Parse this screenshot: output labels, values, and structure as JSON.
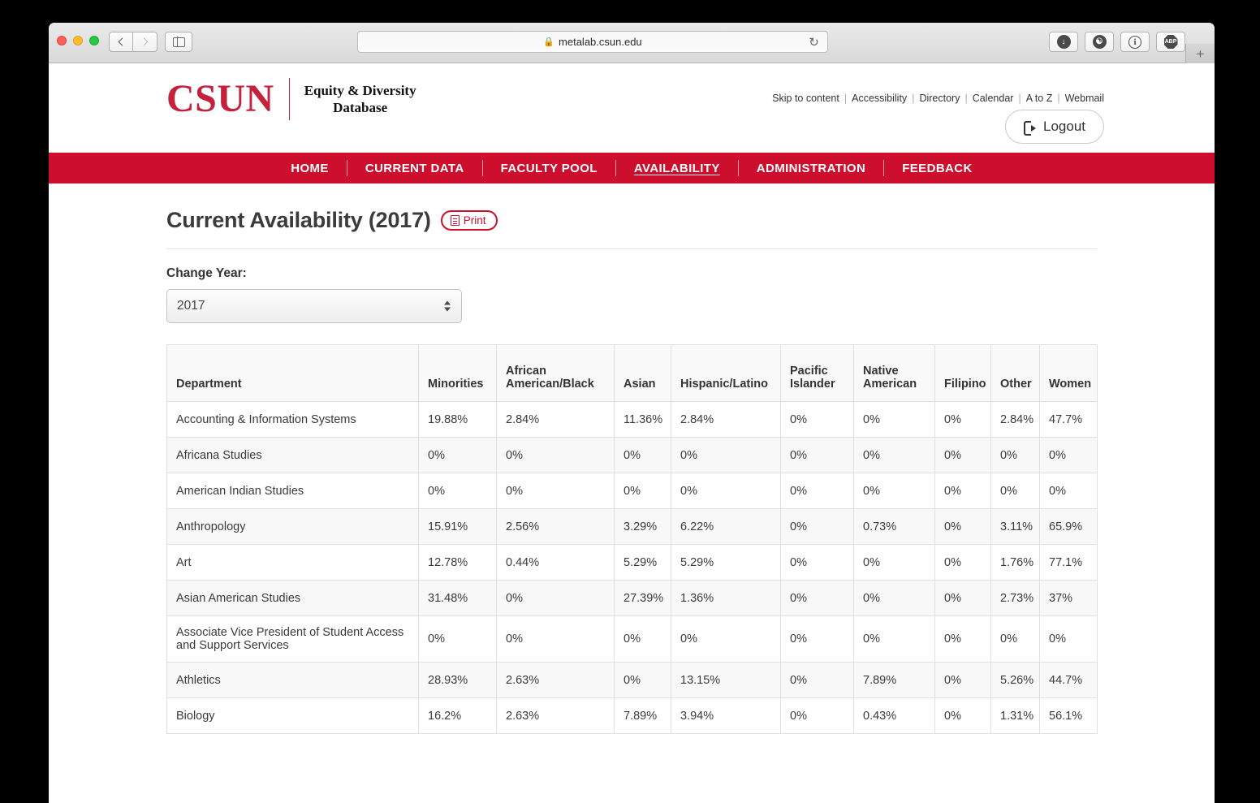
{
  "browser": {
    "url": "metalab.csun.edu",
    "lock_icon": "lock-icon",
    "reload_icon": "reload-icon",
    "back_icon": "back-chevron-icon",
    "forward_icon": "forward-chevron-icon",
    "sidebar_icon": "sidebar-toggle-icon",
    "new_tab_label": "+",
    "extensions": [
      {
        "name": "download-icon",
        "glyph": "↓"
      },
      {
        "name": "github-icon",
        "glyph": "♣"
      },
      {
        "name": "info-icon",
        "glyph": "i"
      },
      {
        "name": "adblock-icon",
        "glyph": "ABP"
      }
    ]
  },
  "site": {
    "logo_wordmark": "CSUN",
    "logo_subtitle_line1": "Equity & Diversity",
    "logo_subtitle_line2": "Database",
    "utility_links": [
      "Skip to content",
      "Accessibility",
      "Directory",
      "Calendar",
      "A to Z",
      "Webmail"
    ],
    "logout_label": "Logout",
    "nav_items": [
      {
        "label": "HOME",
        "active": false
      },
      {
        "label": "CURRENT DATA",
        "active": false
      },
      {
        "label": "FACULTY POOL",
        "active": false
      },
      {
        "label": "AVAILABILITY",
        "active": true
      },
      {
        "label": "ADMINISTRATION",
        "active": false
      },
      {
        "label": "FEEDBACK",
        "active": false
      }
    ],
    "brand_red": "#ce0e2d",
    "logo_red": "#c4223c"
  },
  "main": {
    "page_title": "Current Availability (2017)",
    "print_label": "Print",
    "year_label": "Change Year:",
    "year_value": "2017",
    "table": {
      "columns": [
        "Department",
        "Minorities",
        "African American/Black",
        "Asian",
        "Hispanic/Latino",
        "Pacific Islander",
        "Native American",
        "Filipino",
        "Other",
        "Women"
      ],
      "rows": [
        {
          "department": "Accounting & Information Systems",
          "values": [
            "19.88%",
            "2.84%",
            "11.36%",
            "2.84%",
            "0%",
            "0%",
            "0%",
            "2.84%",
            "47.7%"
          ]
        },
        {
          "department": "Africana Studies",
          "values": [
            "0%",
            "0%",
            "0%",
            "0%",
            "0%",
            "0%",
            "0%",
            "0%",
            "0%"
          ]
        },
        {
          "department": "American Indian Studies",
          "values": [
            "0%",
            "0%",
            "0%",
            "0%",
            "0%",
            "0%",
            "0%",
            "0%",
            "0%"
          ]
        },
        {
          "department": "Anthropology",
          "values": [
            "15.91%",
            "2.56%",
            "3.29%",
            "6.22%",
            "0%",
            "0.73%",
            "0%",
            "3.11%",
            "65.9%"
          ]
        },
        {
          "department": "Art",
          "values": [
            "12.78%",
            "0.44%",
            "5.29%",
            "5.29%",
            "0%",
            "0%",
            "0%",
            "1.76%",
            "77.1%"
          ]
        },
        {
          "department": "Asian American Studies",
          "values": [
            "31.48%",
            "0%",
            "27.39%",
            "1.36%",
            "0%",
            "0%",
            "0%",
            "2.73%",
            "37%"
          ]
        },
        {
          "department": "Associate Vice President of Student Access and Support Services",
          "values": [
            "0%",
            "0%",
            "0%",
            "0%",
            "0%",
            "0%",
            "0%",
            "0%",
            "0%"
          ]
        },
        {
          "department": "Athletics",
          "values": [
            "28.93%",
            "2.63%",
            "0%",
            "13.15%",
            "0%",
            "7.89%",
            "0%",
            "5.26%",
            "44.7%"
          ]
        },
        {
          "department": "Biology",
          "values": [
            "16.2%",
            "2.63%",
            "7.89%",
            "3.94%",
            "0%",
            "0.43%",
            "0%",
            "1.31%",
            "56.1%"
          ]
        }
      ]
    }
  }
}
